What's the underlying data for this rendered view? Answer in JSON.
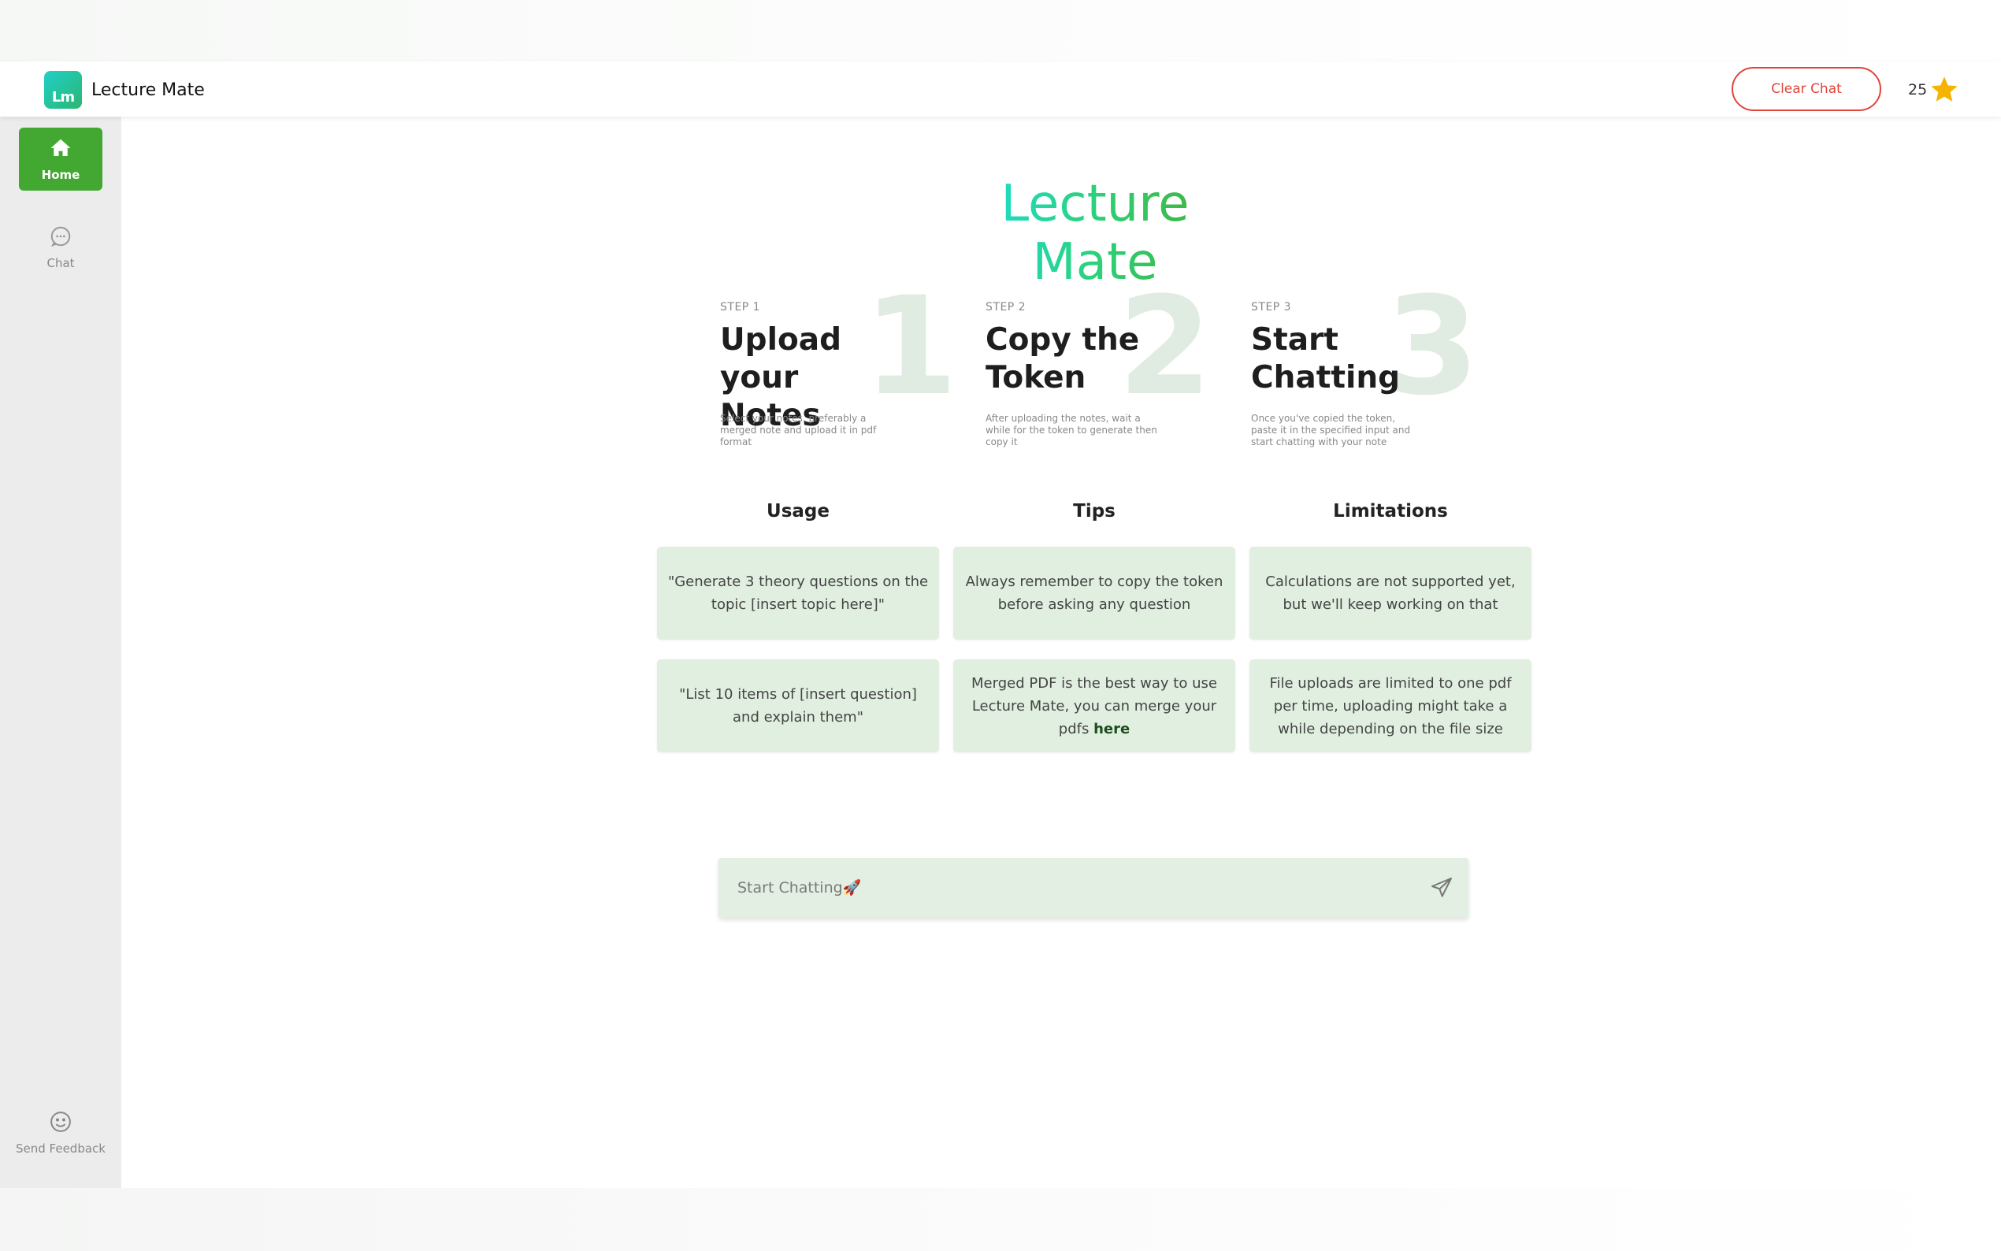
{
  "header": {
    "app_name": "Lecture Mate",
    "logo_text": "Lm",
    "clear_label": "Clear Chat",
    "credits": "25",
    "credit_icon": "star-icon"
  },
  "sidebar": {
    "items": [
      {
        "label": "Home",
        "icon": "home-icon",
        "active": true
      },
      {
        "label": "Chat",
        "icon": "chat-bubble-icon",
        "active": false
      },
      {
        "label": "Send Feedback",
        "icon": "smiley-icon",
        "active": false
      }
    ]
  },
  "main": {
    "title": "Lecture Mate",
    "steps": [
      {
        "label": "STEP 1",
        "number": "1",
        "title": "Upload your Notes",
        "desc": "Select your notes, preferably a merged note and upload it in pdf format"
      },
      {
        "label": "STEP 2",
        "number": "2",
        "title": "Copy the Token",
        "desc": "After uploading the notes, wait a while for the token to generate then copy it"
      },
      {
        "label": "STEP 3",
        "number": "3",
        "title": "Start Chatting",
        "desc": "Once you've copied the token, paste it in the specified input and start chatting with your note"
      }
    ],
    "columns": [
      {
        "heading": "Usage",
        "cards": [
          "\"Generate 3 theory questions on the topic [insert topic here]\"",
          "\"List 10 items of [insert question] and explain them\""
        ]
      },
      {
        "heading": "Tips",
        "cards": [
          "Always remember to copy the token before asking any question",
          "Merged PDF is the best way to use Lecture Mate, you can merge your pdfs"
        ],
        "link_text": "here"
      },
      {
        "heading": "Limitations",
        "cards": [
          "Calculations are not supported yet, but we'll keep working on that",
          "File uploads are limited to one pdf per time, uploading might take a while depending on the file size"
        ]
      }
    ],
    "chat": {
      "placeholder": "Start Chatting🚀",
      "send_icon": "send-icon"
    }
  },
  "colors": {
    "accent_green": "#43a832",
    "card_bg": "#e0efe0",
    "danger": "#e0453b",
    "star": "#f5b400"
  }
}
